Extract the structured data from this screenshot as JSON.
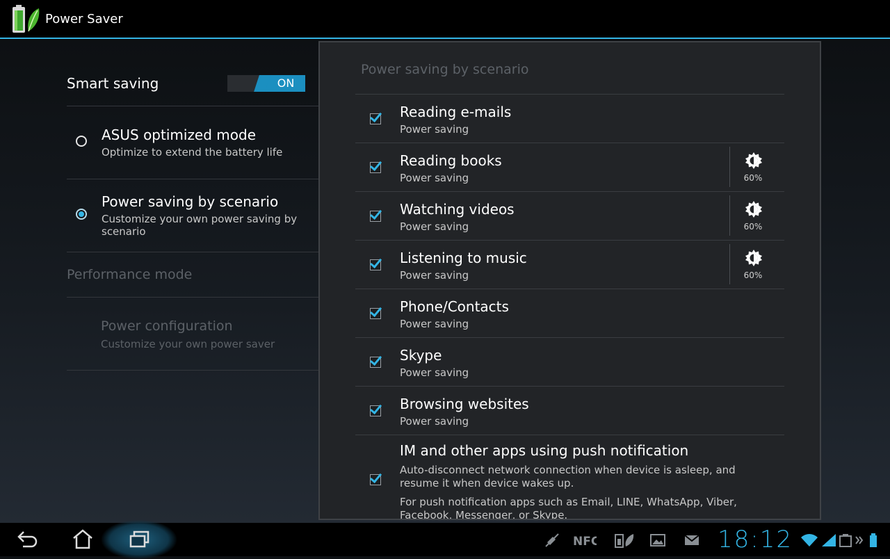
{
  "app": {
    "title": "Power Saver",
    "icon": "battery-leaf-icon"
  },
  "smart_saving": {
    "label": "Smart saving",
    "toggle_value": "ON"
  },
  "modes": [
    {
      "title": "ASUS optimized mode",
      "subtitle": "Optimize to extend the battery life",
      "selected": false
    },
    {
      "title": "Power saving by scenario",
      "subtitle": "Customize your own power saving by scenario",
      "selected": true
    }
  ],
  "performance": {
    "header": "Performance mode",
    "config_title": "Power configuration",
    "config_subtitle": "Customize your own power saver"
  },
  "panel": {
    "title": "Power saving by scenario",
    "items": [
      {
        "title": "Reading e-mails",
        "subtitle": "Power saving",
        "checked": true
      },
      {
        "title": "Reading books",
        "subtitle": "Power saving",
        "checked": true,
        "brightness": "60%"
      },
      {
        "title": "Watching videos",
        "subtitle": "Power saving",
        "checked": true,
        "brightness": "60%"
      },
      {
        "title": "Listening to music",
        "subtitle": "Power saving",
        "checked": true,
        "brightness": "60%"
      },
      {
        "title": "Phone/Contacts",
        "subtitle": "Power saving",
        "checked": true
      },
      {
        "title": "Skype",
        "subtitle": "Power saving",
        "checked": true
      },
      {
        "title": "Browsing websites",
        "subtitle": "Power saving",
        "checked": true
      }
    ],
    "im_item": {
      "title": "IM and other apps using push notification",
      "description1": "Auto-disconnect network connection when device is asleep, and resume it when device wakes up.",
      "description2": "For push notification apps such as Email, LINE, WhatsApp, Viber, Facebook, Messenger, or Skype.",
      "checked": true
    }
  },
  "system_bar": {
    "clock": "18:12",
    "nav": [
      "back-icon",
      "home-icon",
      "recent-apps-icon"
    ],
    "tray": [
      "mute-icon",
      "nfc-icon",
      "battery-saver-icon",
      "image-icon",
      "mail-icon",
      "wifi-icon",
      "signal-icon",
      "battery-icon"
    ],
    "accent": "#33b5e5"
  }
}
